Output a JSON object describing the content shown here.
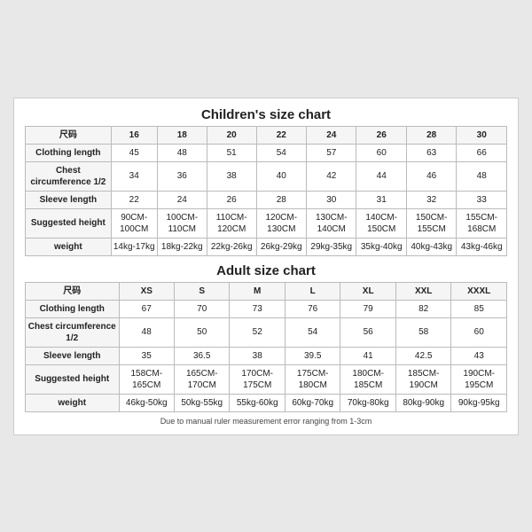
{
  "children_chart": {
    "title": "Children's size chart",
    "headers": [
      "尺码",
      "16",
      "18",
      "20",
      "22",
      "24",
      "26",
      "28",
      "30"
    ],
    "rows": [
      {
        "label": "Clothing length",
        "values": [
          "45",
          "48",
          "51",
          "54",
          "57",
          "60",
          "63",
          "66"
        ]
      },
      {
        "label": "Chest circumference 1/2",
        "values": [
          "34",
          "36",
          "38",
          "40",
          "42",
          "44",
          "46",
          "48"
        ]
      },
      {
        "label": "Sleeve length",
        "values": [
          "22",
          "24",
          "26",
          "28",
          "30",
          "31",
          "32",
          "33"
        ]
      },
      {
        "label": "Suggested height",
        "values": [
          "90CM-100CM",
          "100CM-110CM",
          "110CM-120CM",
          "120CM-130CM",
          "130CM-140CM",
          "140CM-150CM",
          "150CM-155CM",
          "155CM-168CM"
        ]
      },
      {
        "label": "weight",
        "values": [
          "14kg-17kg",
          "18kg-22kg",
          "22kg-26kg",
          "26kg-29kg",
          "29kg-35kg",
          "35kg-40kg",
          "40kg-43kg",
          "43kg-46kg"
        ]
      }
    ]
  },
  "adult_chart": {
    "title": "Adult size chart",
    "headers": [
      "尺码",
      "XS",
      "S",
      "M",
      "L",
      "XL",
      "XXL",
      "XXXL"
    ],
    "rows": [
      {
        "label": "Clothing length",
        "values": [
          "67",
          "70",
          "73",
          "76",
          "79",
          "82",
          "85"
        ]
      },
      {
        "label": "Chest circumference 1/2",
        "values": [
          "48",
          "50",
          "52",
          "54",
          "56",
          "58",
          "60"
        ]
      },
      {
        "label": "Sleeve length",
        "values": [
          "35",
          "36.5",
          "38",
          "39.5",
          "41",
          "42.5",
          "43"
        ]
      },
      {
        "label": "Suggested height",
        "values": [
          "158CM-165CM",
          "165CM-170CM",
          "170CM-175CM",
          "175CM-180CM",
          "180CM-185CM",
          "185CM-190CM",
          "190CM-195CM"
        ]
      },
      {
        "label": "weight",
        "values": [
          "46kg-50kg",
          "50kg-55kg",
          "55kg-60kg",
          "60kg-70kg",
          "70kg-80kg",
          "80kg-90kg",
          "90kg-95kg"
        ]
      }
    ]
  },
  "note": "Due to manual ruler measurement error ranging from 1-3cm"
}
